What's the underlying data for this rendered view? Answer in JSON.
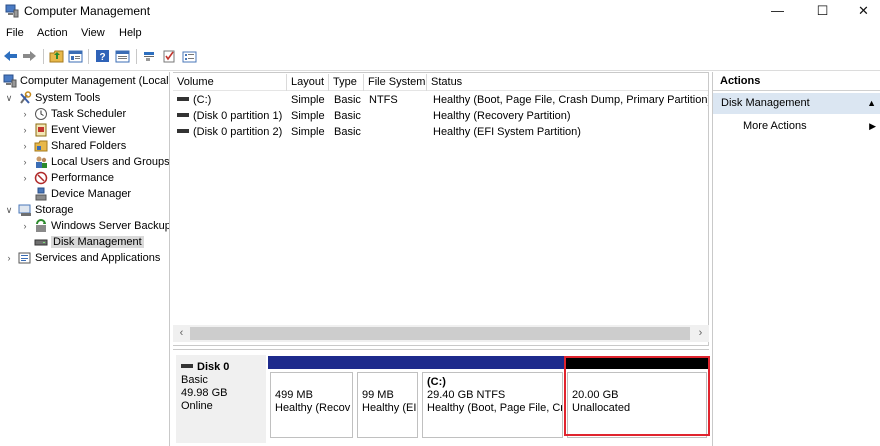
{
  "window": {
    "title": "Computer Management",
    "minimize": "—",
    "maximize": "☐",
    "close": "✕"
  },
  "menu": [
    "File",
    "Action",
    "View",
    "Help"
  ],
  "toolbar_icons": [
    "back-arrow-icon",
    "forward-arrow-icon",
    "up-folder-icon",
    "show-hide-tree-icon",
    "help-icon",
    "console-icon",
    "connect-icon",
    "check-icon",
    "properties-icon"
  ],
  "tree": {
    "root": "Computer Management (Local",
    "system_tools": "System Tools",
    "task_scheduler": "Task Scheduler",
    "event_viewer": "Event Viewer",
    "shared_folders": "Shared Folders",
    "local_users": "Local Users and Groups",
    "performance": "Performance",
    "device_manager": "Device Manager",
    "storage": "Storage",
    "windows_server_backup": "Windows Server Backup",
    "disk_management": "Disk Management",
    "services_apps": "Services and Applications"
  },
  "volume_list": {
    "columns": [
      "Volume",
      "Layout",
      "Type",
      "File System",
      "Status"
    ],
    "rows": [
      {
        "volume": "(C:)",
        "layout": "Simple",
        "type": "Basic",
        "fs": "NTFS",
        "status": "Healthy (Boot, Page File, Crash Dump, Primary Partition)"
      },
      {
        "volume": "(Disk 0 partition 1)",
        "layout": "Simple",
        "type": "Basic",
        "fs": "",
        "status": "Healthy (Recovery Partition)"
      },
      {
        "volume": "(Disk 0 partition 2)",
        "layout": "Simple",
        "type": "Basic",
        "fs": "",
        "status": "Healthy (EFI System Partition)"
      }
    ]
  },
  "scrollbar": {
    "left": "‹",
    "right": "›"
  },
  "disk": {
    "name": "Disk 0",
    "type": "Basic",
    "size": "49.98 GB",
    "state": "Online",
    "partitions": [
      {
        "title": "",
        "size": "499 MB",
        "status": "Healthy (Recov"
      },
      {
        "title": "",
        "size": "99 MB",
        "status": "Healthy (EI"
      },
      {
        "title": "(C:)",
        "size": "29.40 GB NTFS",
        "status": "Healthy (Boot, Page File, Cr"
      },
      {
        "title": "",
        "size": "20.00 GB",
        "status": "Unallocated"
      }
    ]
  },
  "actions": {
    "title": "Actions",
    "section": "Disk Management",
    "more": "More Actions"
  },
  "colors": {
    "primary_partition_band": "#1d2a8c",
    "unallocated_band": "#000000",
    "highlight_border": "#e0242e",
    "actions_section_bg": "#dbe6f2"
  }
}
